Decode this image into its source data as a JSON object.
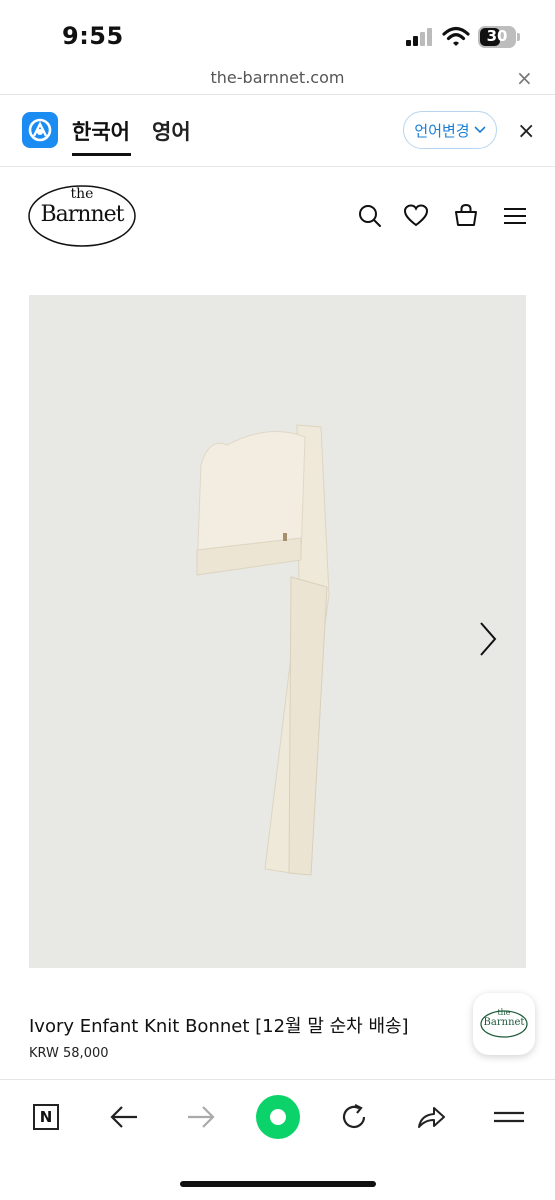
{
  "status_bar": {
    "time": "9:55",
    "battery": "30"
  },
  "url_bar": {
    "url": "the-barnnet.com",
    "close_symbol": "×"
  },
  "translate_bar": {
    "lang_active": "한국어",
    "lang_other": "영어",
    "change_label": "언어변경",
    "close_symbol": "×",
    "accent_color": "#1b8cf2"
  },
  "site": {
    "logo_top": "the",
    "logo_main": "Barnnet",
    "header_icons": [
      "search-icon",
      "heart-icon",
      "bag-icon",
      "menu-icon"
    ]
  },
  "product": {
    "name": "Ivory Enfant Knit Bonnet [12월 말 순차 배송]",
    "price": "KRW 58,000"
  },
  "floating_badge": {
    "logo_top": "the",
    "logo_main": "Barnnet"
  },
  "toolbar": {
    "items": [
      "naver-home-icon",
      "back-arrow-icon",
      "forward-arrow-icon",
      "green-dot-button",
      "reload-icon",
      "share-icon",
      "menu-icon"
    ],
    "home_letter": "N"
  }
}
